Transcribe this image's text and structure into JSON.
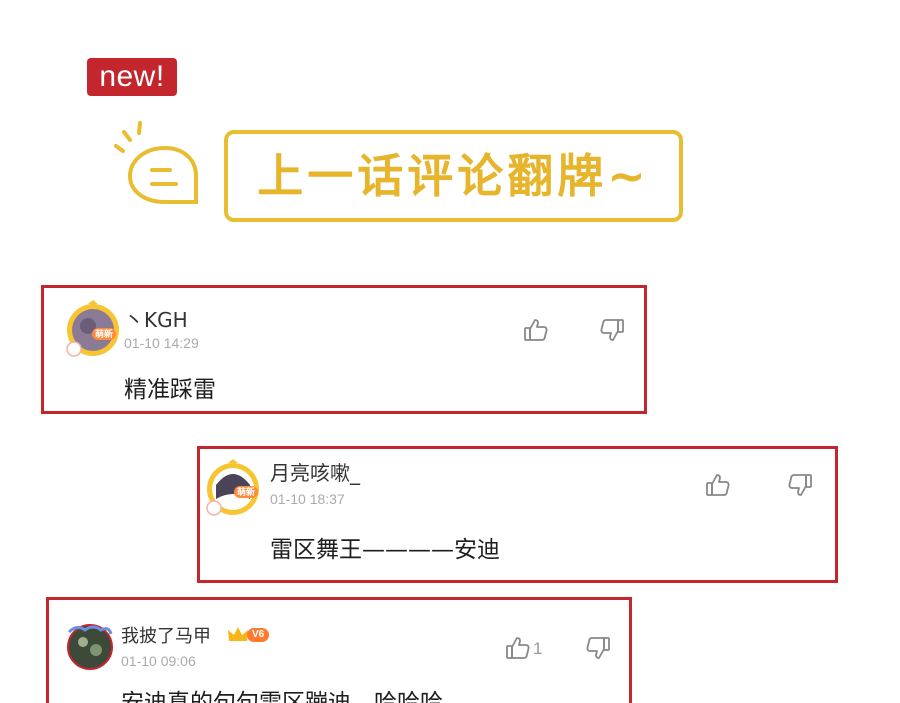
{
  "header": {
    "badge": "new!",
    "title": "上一话评论翻牌~"
  },
  "colors": {
    "accent_red": "#c4262e",
    "title_yellow": "#e9bd32"
  },
  "comments": [
    {
      "user": "丶KGH",
      "time": "01-10 14:29",
      "text": "精准踩雷",
      "avatar_badge": "萌新",
      "like_icon": "thumbs-up-icon",
      "dislike_icon": "thumbs-down-icon"
    },
    {
      "user": "月亮咳嗽_",
      "time": "01-10 18:37",
      "text": "雷区舞王————安迪",
      "avatar_badge": "萌新",
      "like_icon": "thumbs-up-icon",
      "dislike_icon": "thumbs-down-icon"
    },
    {
      "user": "我披了马甲",
      "time": "01-10 09:06",
      "text": "安迪真的句句雷区蹦迪，哈哈哈",
      "vip_level": "V6",
      "like_count": "1",
      "like_icon": "thumbs-up-icon",
      "dislike_icon": "thumbs-down-icon"
    }
  ]
}
